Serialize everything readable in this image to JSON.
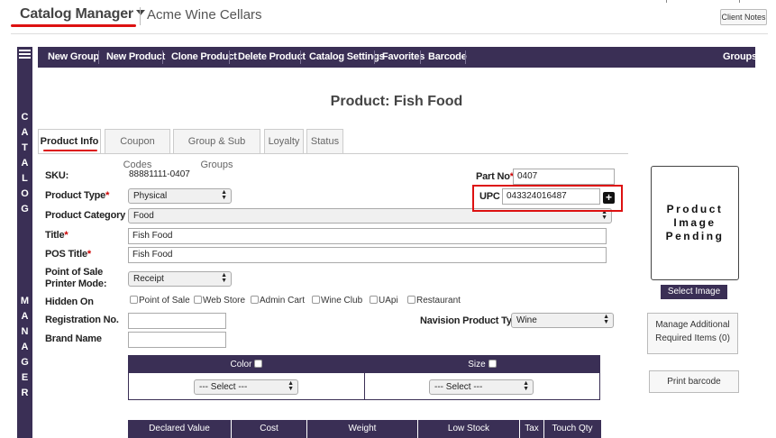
{
  "header": {
    "app_title": "Catalog Manager",
    "company": "Acme Wine Cellars",
    "client_notes": "Client Notes"
  },
  "side_nav": {
    "catalog_letters": [
      "C",
      "A",
      "T",
      "A",
      "L",
      "O",
      "G"
    ],
    "manager_letters": [
      "M",
      "A",
      "N",
      "A",
      "G",
      "E",
      "R"
    ]
  },
  "toolbar": {
    "items": [
      "New Group",
      "New Product",
      "Clone Product",
      "Delete Product",
      "Catalog Settings",
      "Favorites",
      "Barcode"
    ],
    "right_item": "Groups"
  },
  "page": {
    "heading": "Product: Fish Food"
  },
  "tabs": [
    "Product Info",
    "Coupon Codes",
    "Group & Sub Groups",
    "Loyalty",
    "Status"
  ],
  "form": {
    "sku_label": "SKU:",
    "sku_value": "88881111-0407",
    "product_type_label": "Product Type",
    "product_type_value": "Physical",
    "category_label": "Product Category",
    "category_value": "Food",
    "title_label": "Title",
    "title_value": "Fish Food",
    "pos_title_label": "POS Title",
    "pos_title_value": "Fish Food",
    "printer_mode_label_1": "Point of Sale",
    "printer_mode_label_2": "Printer Mode:",
    "printer_mode_value": "Receipt",
    "hidden_on_label": "Hidden On",
    "hidden_on_options": [
      "Point of Sale",
      "Web Store",
      "Admin Cart",
      "Wine Club",
      "UApi",
      "Restaurant"
    ],
    "registration_label": "Registration No.",
    "registration_value": "",
    "brand_label": "Brand Name",
    "brand_value": "",
    "part_no_label": "Part No",
    "part_no_value": "0407",
    "upc_label": "UPC",
    "upc_value": "043324016487",
    "navision_label": "Navision Product Type",
    "navision_value": "Wine",
    "required_mark": "*"
  },
  "image_panel": {
    "pending_line1": "Product",
    "pending_line2": "Image",
    "pending_line3": "Pending",
    "select_image": "Select Image",
    "manage_line1": "Manage Additional",
    "manage_line2": "Required Items (0)",
    "print_barcode": "Print barcode"
  },
  "variants": {
    "color_label": "Color",
    "color_select": "--- Select ---",
    "size_label": "Size",
    "size_select": "--- Select ---"
  },
  "pricing_table": {
    "columns": [
      "Declared Value",
      "Cost",
      "Weight",
      "Low Stock",
      "Tax",
      "Touch Qty"
    ]
  },
  "colors": {
    "brand_purple": "#3a2f55",
    "highlight_red": "#dd1111"
  }
}
